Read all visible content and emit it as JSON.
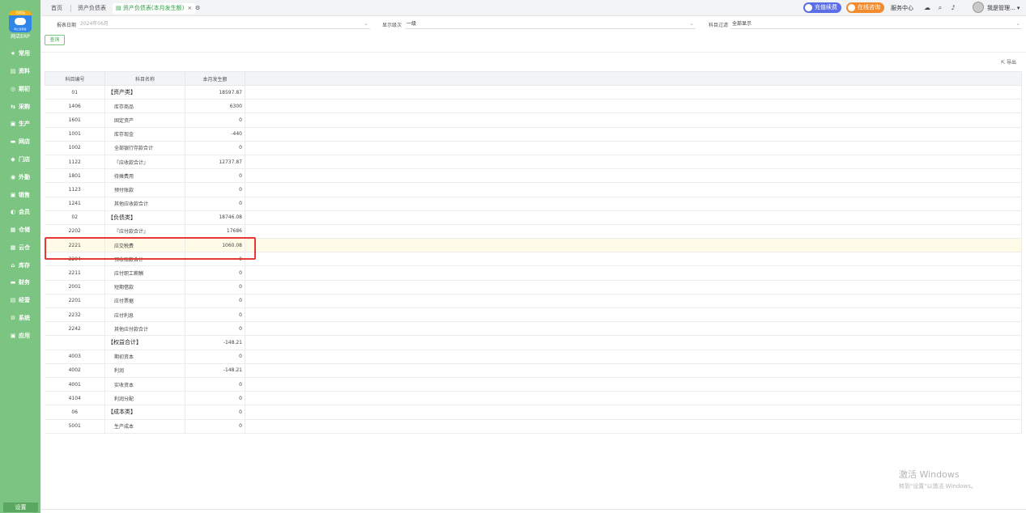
{
  "sidebar": {
    "logo_top": "马蹄云",
    "logo_sub": "网上管家婆",
    "brand": "网店ERP",
    "items": [
      {
        "label": "常用",
        "icon": "★"
      },
      {
        "label": "资料",
        "icon": "▤"
      },
      {
        "label": "期初",
        "icon": "◎"
      },
      {
        "label": "采购",
        "icon": "⇆"
      },
      {
        "label": "生产",
        "icon": "▣"
      },
      {
        "label": "网店",
        "icon": "▬"
      },
      {
        "label": "门店",
        "icon": "◆"
      },
      {
        "label": "外勤",
        "icon": "◉"
      },
      {
        "label": "销售",
        "icon": "▣"
      },
      {
        "label": "会员",
        "icon": "◐"
      },
      {
        "label": "仓储",
        "icon": "▦"
      },
      {
        "label": "云仓",
        "icon": "▦"
      },
      {
        "label": "库存",
        "icon": "⌂"
      },
      {
        "label": "财务",
        "icon": "▬"
      },
      {
        "label": "经营",
        "icon": "▤"
      },
      {
        "label": "系统",
        "icon": "⚙"
      },
      {
        "label": "应用",
        "icon": "▣"
      }
    ],
    "settings": "设置"
  },
  "topbar": {
    "tabs": [
      {
        "label": "首页"
      },
      {
        "label": "资产负债表"
      },
      {
        "label": "资产负债表(本月发生额)"
      }
    ],
    "close_glyph": "×",
    "renew": "充值续费",
    "consult": "在线咨询",
    "service": "服务中心",
    "user": "我是管理..."
  },
  "filters": {
    "period_label": "报表日期",
    "period_value": "2024年06月",
    "level_label": "显示级次",
    "level_value": "一级",
    "subject_label": "科目过滤",
    "subject_value": "全部显示"
  },
  "actions": {
    "query": "查询",
    "export": "导出"
  },
  "table": {
    "headers": [
      "科目编号",
      "科目名称",
      "本月发生额"
    ],
    "rows": [
      {
        "code": "01",
        "name": "【资产类】",
        "amount": "18597.87",
        "group": true
      },
      {
        "code": "1406",
        "name": "库存商品",
        "amount": "6300"
      },
      {
        "code": "1601",
        "name": "固定资产",
        "amount": "0"
      },
      {
        "code": "1001",
        "name": "库存现金",
        "amount": "-440"
      },
      {
        "code": "1002",
        "name": "全部银行存款合计",
        "amount": "0"
      },
      {
        "code": "1122",
        "name": "『应收款合计』",
        "amount": "12737.87"
      },
      {
        "code": "1801",
        "name": "待摊费用",
        "amount": "0"
      },
      {
        "code": "1123",
        "name": "预付账款",
        "amount": "0"
      },
      {
        "code": "1241",
        "name": "其他应收款合计",
        "amount": "0"
      },
      {
        "code": "02",
        "name": "【负债类】",
        "amount": "18746.08",
        "group": true
      },
      {
        "code": "2202",
        "name": "『应付款合计』",
        "amount": "17686"
      },
      {
        "code": "2221",
        "name": "应交税费",
        "amount": "1060.08",
        "highlight": true
      },
      {
        "code": "2204",
        "name": "预收账款合计",
        "amount": "0"
      },
      {
        "code": "2211",
        "name": "应付职工薪酬",
        "amount": "0"
      },
      {
        "code": "2001",
        "name": "短期借款",
        "amount": "0"
      },
      {
        "code": "2201",
        "name": "应付票据",
        "amount": "0"
      },
      {
        "code": "2232",
        "name": "应付利息",
        "amount": "0"
      },
      {
        "code": "2242",
        "name": "其他应付款合计",
        "amount": "0"
      },
      {
        "code": "",
        "name": "【权益合计】",
        "amount": "-148.21",
        "group": true
      },
      {
        "code": "4003",
        "name": "期初资本",
        "amount": "0"
      },
      {
        "code": "4002",
        "name": "利润",
        "amount": "-148.21"
      },
      {
        "code": "4001",
        "name": "实收资本",
        "amount": "0"
      },
      {
        "code": "4104",
        "name": "利润分配",
        "amount": "0"
      },
      {
        "code": "06",
        "name": "【成本类】",
        "amount": "0",
        "group": true
      },
      {
        "code": "5001",
        "name": "生产成本",
        "amount": "0"
      }
    ]
  },
  "watermark": {
    "line1": "激活 Windows",
    "line2": "转到\"设置\"以激活 Windows。"
  },
  "colors": {
    "sidebar": "#7cc481",
    "accent": "#2ea246",
    "highlight_border": "#e53935",
    "highlight_row": "#fffbe6"
  }
}
